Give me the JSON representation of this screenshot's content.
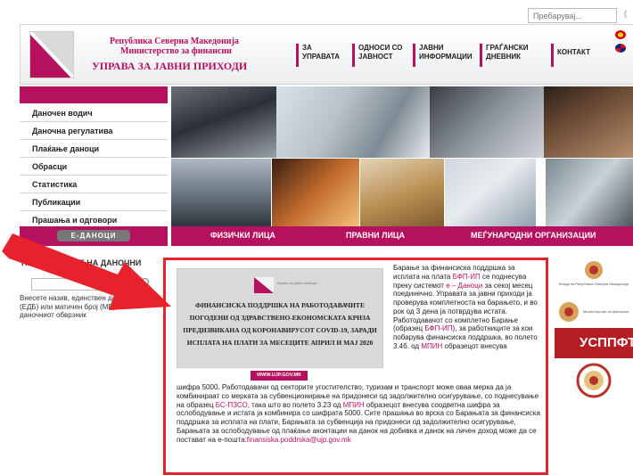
{
  "search": {
    "placeholder": "Пребарувај...",
    "tail": "("
  },
  "header": {
    "org_line1": "Република Северна Македонија",
    "org_line2": "Министерство за финансии",
    "org_main": "УПРАВА ЗА ЈАВНИ ПРИХОДИ"
  },
  "topnav": [
    {
      "label": "ЗА\nУПРАВАТА"
    },
    {
      "label": "ОДНОСИ СО\nЈАВНОСТ"
    },
    {
      "label": "ЈАВНИ\nИНФОРМАЦИИ"
    },
    {
      "label": "ГРАЃАНСКИ\nДНЕВНИК"
    },
    {
      "label": "КОНТАКТ"
    }
  ],
  "sidebar": {
    "items": [
      {
        "label": "Даночен водич"
      },
      {
        "label": "Даночна регулатива"
      },
      {
        "label": "Плаќање даноци"
      },
      {
        "label": "Обрасци"
      },
      {
        "label": "Статистика"
      },
      {
        "label": "Публикации"
      },
      {
        "label": "Прашања и одговори"
      }
    ],
    "edanoci": "Е-ДАНОЦИ"
  },
  "tabs": [
    {
      "label": "ФИЗИЧКИ ЛИЦА"
    },
    {
      "label": "ПРАВНИ ЛИЦА"
    },
    {
      "label": "МЕЃУНАРОДНИ ОРГАНИЗАЦИИ"
    }
  ],
  "tax_search": {
    "heading": "ПРЕБАРУВАЊЕ НА ДАНОЧНИ",
    "description": "Внесете назив, единствен даночен број (ЕДБ) или матичен број (МБ) на даночниот обврзник"
  },
  "article": {
    "banner_logo_text": "Управа за јавни приходи",
    "banner_title": "ФИНАНСИСКА ПОДДРШКА НА РАБОТОДАВАЧИТЕ ПОГОДЕНИ ОД ЗДРАВСТВЕНО-ЕКОНОМСКАТА КРИЗА ПРЕДИЗВИКАНА ОД КОРОНАВИРУСОТ COVID-19, ЗАРАДИ ИСПЛАТА НА ПЛАТИ ЗА МЕСЕЦИТЕ АПРИЛ И МАЈ 2020",
    "banner_url": "WWW.UJP.GOV.MK",
    "p1": "Барање за финансиска поддршка за исплата на плата ",
    "p1_hl": "БФП-ИП",
    "p2": " се поднесува преку системот ",
    "p2_hl": "е – Даноци",
    "p3": " за секој месец поединечно. Управата за јавни приходи ја проверува комплетноста на барањето, и во рок од 3 дена ја потврдува истата. Работодавачот со комплетно Барање (образец ",
    "p3_hl": "БФП-ИП",
    "p4": "), за работниците за кои побарува финансиска поддршка, во полето 3.4б. од ",
    "p4_hl": "МПИН",
    "p5": " образецот внесува",
    "b1": "шифра 5000. Работодавачи од секторите угостителство, туризам и транспорт може оваа мерка да ја комбинираат со мерката за субвенционирање на придонеси од задолжително осигурување, со поднесување на образец ",
    "b1_hl": "БС-ПЗСО",
    "b2": ", така што во полето 3.23 од ",
    "b2_hl": "МПИН",
    "b3": " образецот внесува соодветна шифра за ослободување и истата ја комбинира со шифрата 5000. Сите прашања во врска со Барањата за финансиска поддршка за исплата на плати, Барањата за субвенција на придонеси од задолжително осигурување, Барањата за ослободување од плаќање аконтации на данок на добивка и данок на личен доход може да се постават на е-пошта:",
    "b3_hl": "finansiska.poddrska@ujp.gov.mk"
  },
  "right_logos": {
    "usppft": "УСППФТ",
    "logo1_text": "Влада на Република Северна Македонија",
    "logo2_text": "Министерство за финансии"
  },
  "colors": {
    "brand": "#b5115f",
    "highlight_box": "#e8222c",
    "arrow": "#e8222c"
  }
}
